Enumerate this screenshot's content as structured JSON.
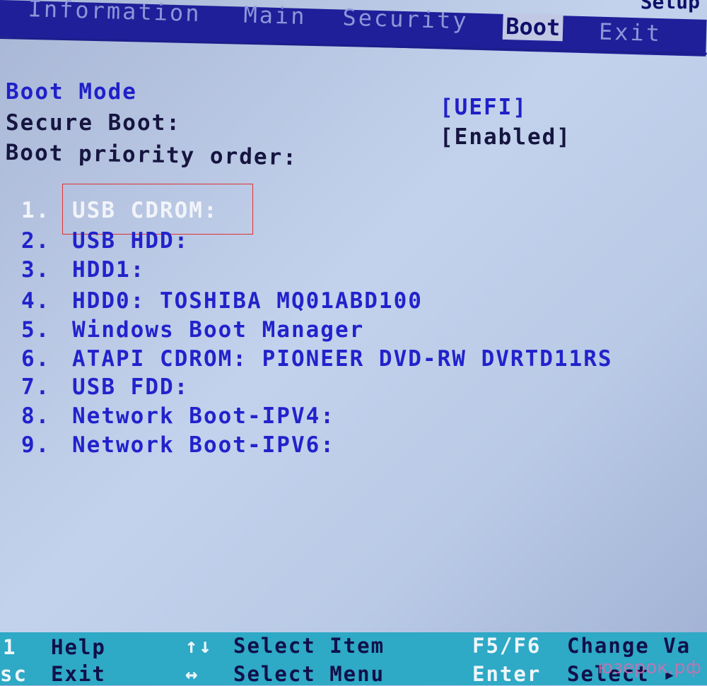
{
  "menu": {
    "title_fragment": "Setup",
    "tabs": [
      {
        "label": "Information",
        "selected": false
      },
      {
        "label": "Main",
        "selected": false
      },
      {
        "label": "Security",
        "selected": false
      },
      {
        "label": "Boot",
        "selected": true
      },
      {
        "label": "Exit",
        "selected": false
      }
    ]
  },
  "settings": {
    "boot_mode_label": "Boot Mode",
    "boot_mode_value": "[UEFI]",
    "secure_boot_label": "Secure Boot:",
    "secure_boot_value": "[Enabled]",
    "priority_label": "Boot priority order:"
  },
  "boot_order": [
    {
      "num": "1.",
      "label": "USB CDROM:",
      "selected": true
    },
    {
      "num": "2.",
      "label": "USB HDD:"
    },
    {
      "num": "3.",
      "label": "HDD1:"
    },
    {
      "num": "4.",
      "label": "HDD0: TOSHIBA MQ01ABD100"
    },
    {
      "num": "5.",
      "label": "Windows Boot Manager"
    },
    {
      "num": "6.",
      "label": "ATAPI CDROM: PIONEER DVD-RW DVRTD11RS"
    },
    {
      "num": "7.",
      "label": "USB FDD:"
    },
    {
      "num": "8.",
      "label": "Network Boot-IPV4:"
    },
    {
      "num": "9.",
      "label": "Network Boot-IPV6:"
    }
  ],
  "footer": [
    {
      "key": "1",
      "desc": "Help"
    },
    {
      "key": "sc",
      "desc": "Exit"
    },
    {
      "key": "↑↓",
      "desc": "Select Item"
    },
    {
      "key": "↔",
      "desc": "Select Menu"
    },
    {
      "key": "F5/F6",
      "desc": "Change Va"
    },
    {
      "key": "Enter",
      "desc": "Select ▸"
    }
  ],
  "watermark": "юзерок.рф",
  "colors": {
    "menu_bar": "#1f1f9a",
    "body_bg": "#b9cae6",
    "item_text": "#2222cc",
    "footer_bg": "#2ea9c6",
    "highlight_box": "#e03030"
  }
}
